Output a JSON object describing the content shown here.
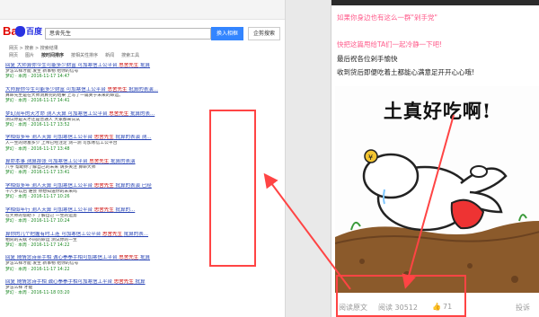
{
  "baidu": {
    "logo_bai": "Bai",
    "logo_du": "百度",
    "query": "思舍先生",
    "search_button": "换入相框",
    "clip_button": "企剪搜索",
    "breadcrumb": "网页 > 搜索 > 搜索结果",
    "tools": [
      {
        "label": "网页",
        "active": false
      },
      {
        "label": "图片",
        "active": false
      },
      {
        "label": "按时间排序",
        "active": true
      },
      {
        "label": "按相关性排序",
        "active": false
      },
      {
        "label": "新闻",
        "active": false
      },
      {
        "label": "搜索工具",
        "active": false
      }
    ],
    "results": [
      {
        "title": "回复 大师算你今生可能多少财富 可加寒信工公平台",
        "hl": "思舍先生",
        "tail": "批算",
        "snip": "梦怎么样才能 发生 新事物 给你的信号",
        "meta": "梦幻 · 本周 · 2016-11-17 14:47"
      },
      {
        "title": "大师算你今生可能多少财富 可加寒信工公平台",
        "hl": "思舍先生",
        "tail": "批算的表演...",
        "snip": "算命先生是在大师测算完的结果 上写了一篇关于未来的命运。",
        "meta": "梦幻 · 本周 · 2016-11-17 14:41"
      },
      {
        "title": "梦幻流年的天才命 测人天算 可加寒信工公平台",
        "hl": "思舍先生",
        "tail": "批算的表...",
        "snip": "测试你是天才还是普通人 大家都来试试",
        "meta": "梦幻 · 本周 · 2016-11-17 13:52"
      },
      {
        "title": "学相似多年 测人天算 可加寒信工公平台",
        "hl": "思舍先生",
        "tail": "批算的表演 测...",
        "snip": "人一生的财富多少 上帝已经注定 测一测 可加寒信工公平台",
        "meta": "梦幻 · 本周 · 2016-11-17 13:48"
      },
      {
        "title": "算命本事 测算那张 可加寒信工公平台",
        "hl": "思舍先生",
        "tail": "批算的表演",
        "snip": "八字 帮助你了解自己的未来 请多关注 算命大师",
        "meta": "梦幻 · 本周 · 2016-11-17 13:41"
      },
      {
        "title": "学相似多年 测人天算 可加寒信工公平台",
        "hl": "思舍先生",
        "tail": "批算的表演 已经",
        "snip": "十八岁以后 谁会 你想知道你的未来吗",
        "meta": "梦幻 · 本周 · 2016-11-17 10:26"
      },
      {
        "title": "学相似年行 测人天算 可加寒信工公平台",
        "hl": "思舍先生",
        "tail": "批算的...",
        "snip": "在大师的帮助下 了解自己 一生的运势",
        "meta": "梦幻 · 本周 · 2016-11-17 10:24"
      },
      {
        "title": "算你的几个把握有时工连 可加寒信工公平台",
        "hl": "思舍先生",
        "tail": "批算的表...",
        "snip": "相同的天赋 不同的命运 测试你的一生",
        "meta": "梦幻 · 本周 · 2016-11-17 14:22"
      },
      {
        "title": "回复 随情念诗亲手相 诚心拳拳手相可加寒信工平台",
        "hl": "思舍先生",
        "tail": "批算",
        "snip": "梦怎么样才能 发生 新事物 给你的信号",
        "meta": "梦幻 · 本周 · 2016-11-17 14:22"
      },
      {
        "title": "回复 随情念诗手相 诚心拳拳手相可加寒信工平台",
        "hl": "思舍先生",
        "tail": "批算",
        "snip": "梦怎么样 才能",
        "meta": "梦幻 · 本周 · 2016-11-18 03:20"
      }
    ]
  },
  "article": {
    "pink_line_1": "如果你身边也有这么一群\"剁手党\"",
    "pink_line_2": "快把这篇甩给TA们一起冷静一下吧!",
    "line_3": "最后祝各位剁手愉快",
    "line_4": "收到货后即便吃着土都能心满意足开开心心哦!",
    "meme_caption": "土真好吃啊!",
    "read_original": "阅读原文",
    "reads_label": "阅读 30512",
    "likes": "71",
    "report": "投诉"
  },
  "colors": {
    "highlight_red": "#ff4444",
    "baidu_link": "#2440b3",
    "baidu_blue": "#3385ff",
    "pink": "#ff5a8a"
  }
}
